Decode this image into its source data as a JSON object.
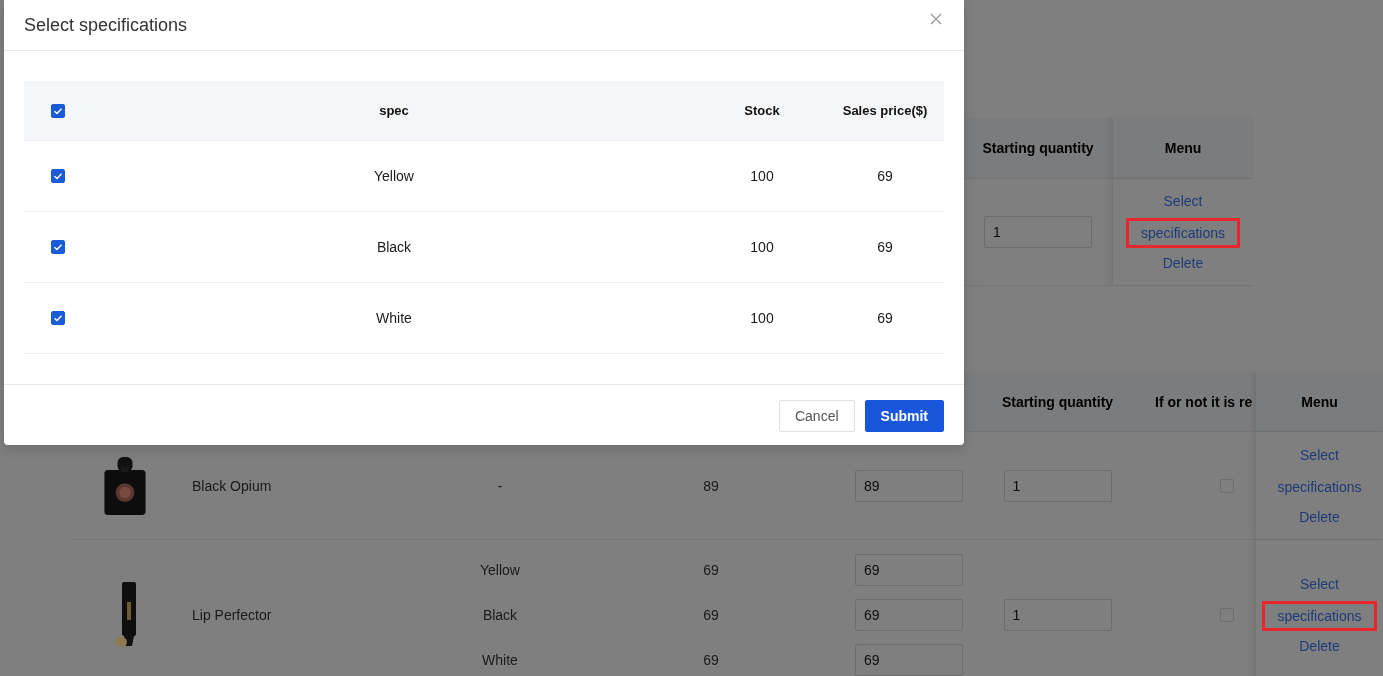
{
  "modal": {
    "title": "Select specifications",
    "table": {
      "all_checked": true,
      "columns": [
        "spec",
        "Stock",
        "Sales price($)"
      ],
      "rows": [
        {
          "checked": true,
          "spec": "Yellow",
          "stock": "100",
          "sales_price": "69"
        },
        {
          "checked": true,
          "spec": "Black",
          "stock": "100",
          "sales_price": "69"
        },
        {
          "checked": true,
          "spec": "White",
          "stock": "100",
          "sales_price": "69"
        }
      ]
    },
    "buttons": [
      {
        "label": "Cancel",
        "kind": "default"
      },
      {
        "label": "Submit",
        "kind": "primary"
      }
    ]
  },
  "upper_table": {
    "columns": [
      "Starting quantity",
      "Menu"
    ],
    "rows": [
      {
        "starting_quantity": "1",
        "actions": [
          {
            "label": "Select",
            "highlighted": false
          },
          {
            "label": "specifications",
            "highlighted": true
          },
          {
            "label": "Delete",
            "highlighted": false
          }
        ]
      }
    ]
  },
  "lower_table": {
    "columns": [
      "Starting quantity",
      "If or not it is re",
      "Menu"
    ],
    "rows": [
      {
        "image": {
          "kind": "picture"
        },
        "name": "Black Opium",
        "specs": [
          {
            "spec": "-",
            "price": "89",
            "sales_price": "89"
          }
        ],
        "starting_quantity": "1",
        "required": false,
        "actions": [
          {
            "label": "Select",
            "highlighted": false
          },
          {
            "label": "specifications",
            "highlighted": false
          },
          {
            "label": "Delete",
            "highlighted": false
          }
        ]
      },
      {
        "image": {
          "kind": "picture"
        },
        "name": "Lip Perfector",
        "specs": [
          {
            "spec": "Yellow",
            "price": "69",
            "sales_price": "69"
          },
          {
            "spec": "Black",
            "price": "69",
            "sales_price": "69"
          },
          {
            "spec": "White",
            "price": "69",
            "sales_price": "69"
          }
        ],
        "starting_quantity": "1",
        "required": false,
        "actions": [
          {
            "label": "Select",
            "highlighted": false
          },
          {
            "label": "specifications",
            "highlighted": true
          },
          {
            "label": "Delete",
            "highlighted": false
          }
        ]
      }
    ]
  }
}
